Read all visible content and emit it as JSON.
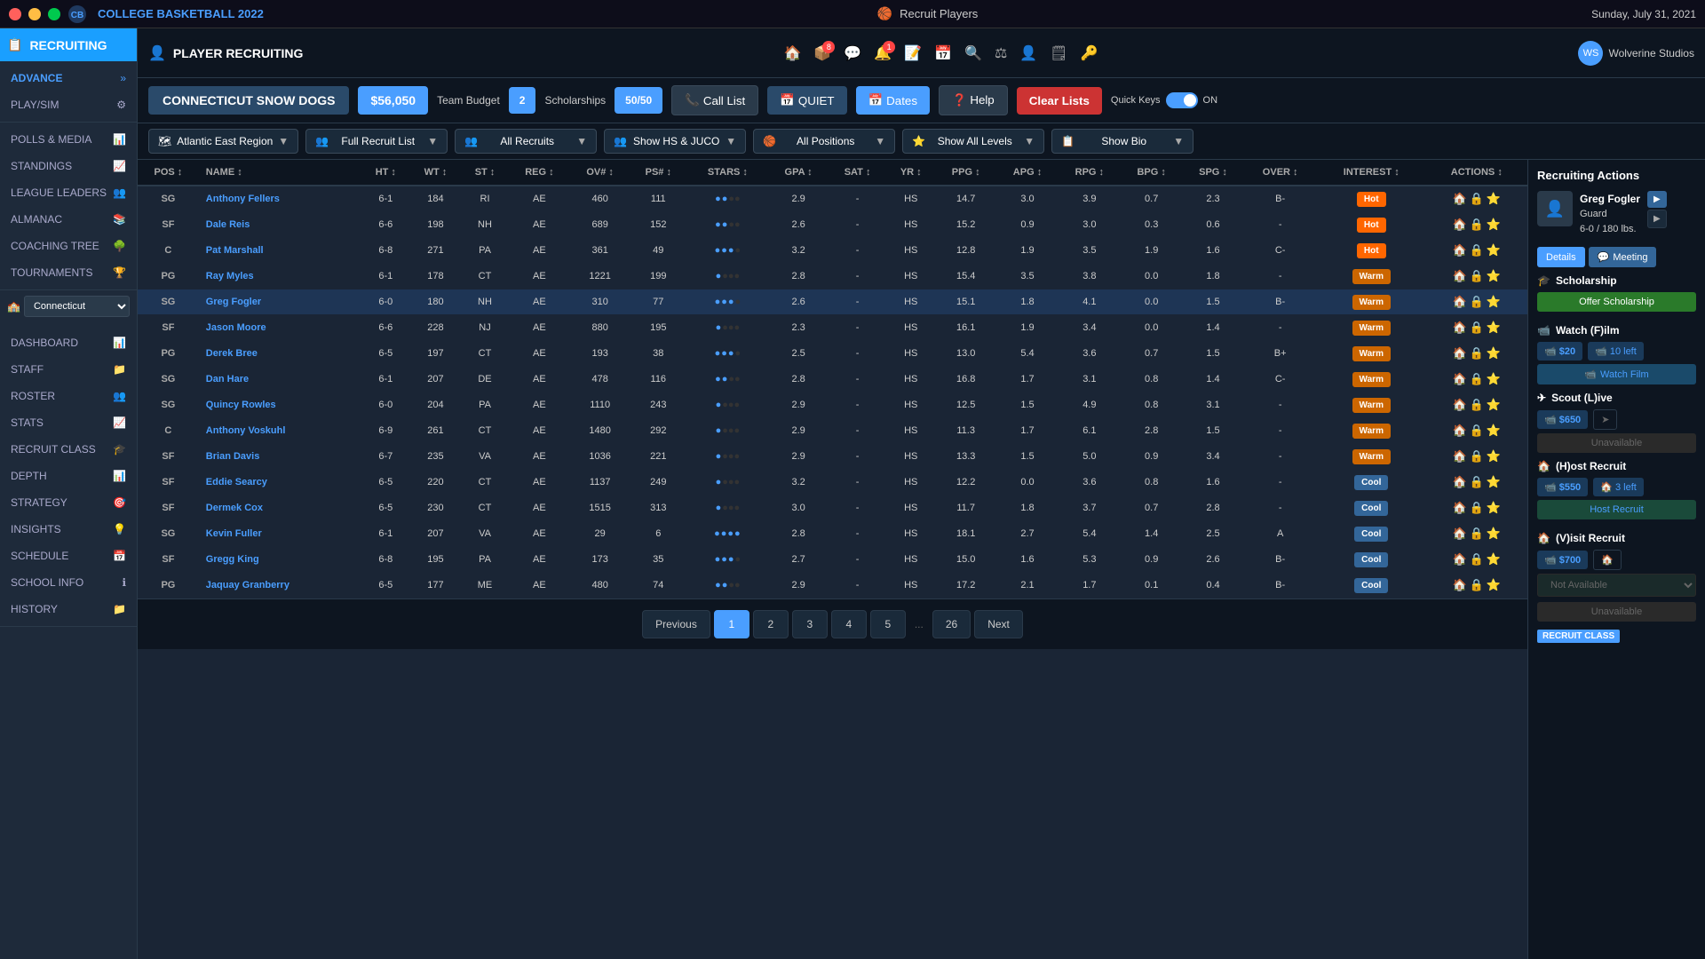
{
  "titleBar": {
    "title": "Recruit Players",
    "date": "Sunday, July 31, 2021",
    "gameName": "COLLEGE BASKETBALL 2022",
    "minLabel": "—",
    "maxLabel": "□",
    "closeLabel": "×"
  },
  "sidebar": {
    "activeSection": "RECRUITING",
    "sectionLabel": "RECRUITING",
    "items": [
      {
        "id": "advance",
        "label": "ADVANCE",
        "hasArrow": true
      },
      {
        "id": "play-sim",
        "label": "PLAY/SIM",
        "hasIcon": true
      },
      {
        "id": "polls-media",
        "label": "POLLS & MEDIA"
      },
      {
        "id": "standings",
        "label": "STANDINGS"
      },
      {
        "id": "league-leaders",
        "label": "LEAGUE LEADERS"
      },
      {
        "id": "almanac",
        "label": "ALMANAC"
      },
      {
        "id": "coaching-tree",
        "label": "COACHING TREE"
      },
      {
        "id": "tournaments",
        "label": "TOURNAMENTS"
      },
      {
        "id": "dashboard",
        "label": "DASHBOARD"
      },
      {
        "id": "staff",
        "label": "STAFF"
      },
      {
        "id": "roster",
        "label": "ROSTER"
      },
      {
        "id": "stats",
        "label": "STATS"
      },
      {
        "id": "recruit-class",
        "label": "RECRUIT CLASS"
      },
      {
        "id": "depth",
        "label": "DEPTH"
      },
      {
        "id": "strategy",
        "label": "STRATEGY"
      },
      {
        "id": "insights",
        "label": "INSIGHTS"
      },
      {
        "id": "schedule",
        "label": "SCHEDULE"
      },
      {
        "id": "school-info",
        "label": "SCHOOL INFO"
      },
      {
        "id": "history",
        "label": "HISTORY"
      }
    ],
    "teamLabel": "Connecticut"
  },
  "header": {
    "section": "PLAYER RECRUITING",
    "teamName": "CONNECTICUT SNOW DOGS",
    "budget": "$56,050",
    "budgetLabel": "Team Budget",
    "scholarships": "2",
    "scholarshipsLabel": "Scholarships",
    "slots": "50/50",
    "callListLabel": "Call List",
    "quietLabel": "QUIET",
    "datesLabel": "Dates",
    "helpLabel": "Help",
    "clearLabel": "Clear Lists",
    "quickKeysLabel": "Quick Keys",
    "toggleState": "ON"
  },
  "filters": {
    "region": "Atlantic East Region",
    "listType": "Full Recruit List",
    "recruits": "All Recruits",
    "school": "Show HS & JUCO",
    "positions": "All Positions",
    "levels": "Show All Levels",
    "bio": "Show Bio"
  },
  "table": {
    "columns": [
      "POS",
      "NAME",
      "HT",
      "WT",
      "ST",
      "REG",
      "OV#",
      "PS#",
      "STARS",
      "GPA",
      "SAT",
      "YR",
      "PPG",
      "APG",
      "RPG",
      "BPG",
      "SPG",
      "OVER",
      "INTEREST",
      "ACTIONS"
    ],
    "rows": [
      {
        "pos": "SG",
        "name": "Anthony Fellers",
        "ht": "6-1",
        "wt": "184",
        "st": "RI",
        "reg": "AE",
        "ov": "460",
        "ps": "111",
        "stars": 2,
        "gpa": "2.9",
        "sat": "-",
        "yr": "HS",
        "ppg": "14.7",
        "apg": "3.0",
        "rpg": "3.9",
        "bpg": "0.7",
        "spg": "2.3",
        "over": "B-",
        "interest": "Hot",
        "selected": false
      },
      {
        "pos": "SF",
        "name": "Dale Reis",
        "ht": "6-6",
        "wt": "198",
        "st": "NH",
        "reg": "AE",
        "ov": "689",
        "ps": "152",
        "stars": 2,
        "gpa": "2.6",
        "sat": "-",
        "yr": "HS",
        "ppg": "15.2",
        "apg": "0.9",
        "rpg": "3.0",
        "bpg": "0.3",
        "spg": "0.6",
        "over": "-",
        "interest": "Hot",
        "selected": false
      },
      {
        "pos": "C",
        "name": "Pat Marshall",
        "ht": "6-8",
        "wt": "271",
        "st": "PA",
        "reg": "AE",
        "ov": "361",
        "ps": "49",
        "stars": 3,
        "gpa": "3.2",
        "sat": "-",
        "yr": "HS",
        "ppg": "12.8",
        "apg": "1.9",
        "rpg": "3.5",
        "bpg": "1.9",
        "spg": "1.6",
        "over": "C-",
        "interest": "Hot",
        "selected": false
      },
      {
        "pos": "PG",
        "name": "Ray Myles",
        "ht": "6-1",
        "wt": "178",
        "st": "CT",
        "reg": "AE",
        "ov": "1221",
        "ps": "199",
        "stars": 1,
        "gpa": "2.8",
        "sat": "-",
        "yr": "HS",
        "ppg": "15.4",
        "apg": "3.5",
        "rpg": "3.8",
        "bpg": "0.0",
        "spg": "1.8",
        "over": "-",
        "interest": "Warm",
        "selected": false
      },
      {
        "pos": "SG",
        "name": "Greg Fogler",
        "ht": "6-0",
        "wt": "180",
        "st": "NH",
        "reg": "AE",
        "ov": "310",
        "ps": "77",
        "stars": 3,
        "gpa": "2.6",
        "sat": "-",
        "yr": "HS",
        "ppg": "15.1",
        "apg": "1.8",
        "rpg": "4.1",
        "bpg": "0.0",
        "spg": "1.5",
        "over": "B-",
        "interest": "Warm",
        "selected": true
      },
      {
        "pos": "SF",
        "name": "Jason Moore",
        "ht": "6-6",
        "wt": "228",
        "st": "NJ",
        "reg": "AE",
        "ov": "880",
        "ps": "195",
        "stars": 1,
        "gpa": "2.3",
        "sat": "-",
        "yr": "HS",
        "ppg": "16.1",
        "apg": "1.9",
        "rpg": "3.4",
        "bpg": "0.0",
        "spg": "1.4",
        "over": "-",
        "interest": "Warm",
        "selected": false
      },
      {
        "pos": "PG",
        "name": "Derek Bree",
        "ht": "6-5",
        "wt": "197",
        "st": "CT",
        "reg": "AE",
        "ov": "193",
        "ps": "38",
        "stars": 3,
        "gpa": "2.5",
        "sat": "-",
        "yr": "HS",
        "ppg": "13.0",
        "apg": "5.4",
        "rpg": "3.6",
        "bpg": "0.7",
        "spg": "1.5",
        "over": "B+",
        "interest": "Warm",
        "selected": false
      },
      {
        "pos": "SG",
        "name": "Dan Hare",
        "ht": "6-1",
        "wt": "207",
        "st": "DE",
        "reg": "AE",
        "ov": "478",
        "ps": "116",
        "stars": 2,
        "gpa": "2.8",
        "sat": "-",
        "yr": "HS",
        "ppg": "16.8",
        "apg": "1.7",
        "rpg": "3.1",
        "bpg": "0.8",
        "spg": "1.4",
        "over": "C-",
        "interest": "Warm",
        "selected": false
      },
      {
        "pos": "SG",
        "name": "Quincy Rowles",
        "ht": "6-0",
        "wt": "204",
        "st": "PA",
        "reg": "AE",
        "ov": "1110",
        "ps": "243",
        "stars": 1,
        "gpa": "2.9",
        "sat": "-",
        "yr": "HS",
        "ppg": "12.5",
        "apg": "1.5",
        "rpg": "4.9",
        "bpg": "0.8",
        "spg": "3.1",
        "over": "-",
        "interest": "Warm",
        "selected": false
      },
      {
        "pos": "C",
        "name": "Anthony Voskuhl",
        "ht": "6-9",
        "wt": "261",
        "st": "CT",
        "reg": "AE",
        "ov": "1480",
        "ps": "292",
        "stars": 1,
        "gpa": "2.9",
        "sat": "-",
        "yr": "HS",
        "ppg": "11.3",
        "apg": "1.7",
        "rpg": "6.1",
        "bpg": "2.8",
        "spg": "1.5",
        "over": "-",
        "interest": "Warm",
        "selected": false
      },
      {
        "pos": "SF",
        "name": "Brian Davis",
        "ht": "6-7",
        "wt": "235",
        "st": "VA",
        "reg": "AE",
        "ov": "1036",
        "ps": "221",
        "stars": 1,
        "gpa": "2.9",
        "sat": "-",
        "yr": "HS",
        "ppg": "13.3",
        "apg": "1.5",
        "rpg": "5.0",
        "bpg": "0.9",
        "spg": "3.4",
        "over": "-",
        "interest": "Warm",
        "selected": false
      },
      {
        "pos": "SF",
        "name": "Eddie Searcy",
        "ht": "6-5",
        "wt": "220",
        "st": "CT",
        "reg": "AE",
        "ov": "1137",
        "ps": "249",
        "stars": 1,
        "gpa": "3.2",
        "sat": "-",
        "yr": "HS",
        "ppg": "12.2",
        "apg": "0.0",
        "rpg": "3.6",
        "bpg": "0.8",
        "spg": "1.6",
        "over": "-",
        "interest": "Cool",
        "selected": false
      },
      {
        "pos": "SF",
        "name": "Dermek Cox",
        "ht": "6-5",
        "wt": "230",
        "st": "CT",
        "reg": "AE",
        "ov": "1515",
        "ps": "313",
        "stars": 1,
        "gpa": "3.0",
        "sat": "-",
        "yr": "HS",
        "ppg": "11.7",
        "apg": "1.8",
        "rpg": "3.7",
        "bpg": "0.7",
        "spg": "2.8",
        "over": "-",
        "interest": "Cool",
        "selected": false
      },
      {
        "pos": "SG",
        "name": "Kevin Fuller",
        "ht": "6-1",
        "wt": "207",
        "st": "VA",
        "reg": "AE",
        "ov": "29",
        "ps": "6",
        "stars": 4,
        "gpa": "2.8",
        "sat": "-",
        "yr": "HS",
        "ppg": "18.1",
        "apg": "2.7",
        "rpg": "5.4",
        "bpg": "1.4",
        "spg": "2.5",
        "over": "A",
        "interest": "Cool",
        "selected": false
      },
      {
        "pos": "SF",
        "name": "Gregg King",
        "ht": "6-8",
        "wt": "195",
        "st": "PA",
        "reg": "AE",
        "ov": "173",
        "ps": "35",
        "stars": 3,
        "gpa": "2.7",
        "sat": "-",
        "yr": "HS",
        "ppg": "15.0",
        "apg": "1.6",
        "rpg": "5.3",
        "bpg": "0.9",
        "spg": "2.6",
        "over": "B-",
        "interest": "Cool",
        "selected": false
      },
      {
        "pos": "PG",
        "name": "Jaquay Granberry",
        "ht": "6-5",
        "wt": "177",
        "st": "ME",
        "reg": "AE",
        "ov": "480",
        "ps": "74",
        "stars": 2,
        "gpa": "2.9",
        "sat": "-",
        "yr": "HS",
        "ppg": "17.2",
        "apg": "2.1",
        "rpg": "1.7",
        "bpg": "0.1",
        "spg": "0.4",
        "over": "B-",
        "interest": "Cool",
        "selected": false
      }
    ]
  },
  "pagination": {
    "previousLabel": "Previous",
    "nextLabel": "Next",
    "currentPage": 1,
    "pages": [
      "1",
      "2",
      "3",
      "4",
      "5",
      "...",
      "26"
    ]
  },
  "rightPanel": {
    "title": "Recruiting Actions",
    "recruitName": "Greg Fogler",
    "recruitPos": "Guard",
    "recruitStats": "6-0 / 180 lbs.",
    "detailsLabel": "Details",
    "meetingLabel": "Meeting",
    "scholarshipLabel": "Scholarship",
    "offerLabel": "Offer Scholarship",
    "watchFilmLabel": "Watch (F)ilm",
    "watchCost": "$20",
    "watchLeft": "10 left",
    "watchFilmBtnLabel": "Watch Film",
    "scoutLabel": "Scout (L)ive",
    "scoutCost": "$650",
    "scoutUnavailLabel": "Unavailable",
    "hostLabel": "(H)ost Recruit",
    "hostCost": "$550",
    "hostLeft": "3 left",
    "hostFilmBtnLabel": "Host Recruit",
    "visitLabel": "(V)isit Recruit",
    "visitCost": "$700",
    "visitNotAvailLabel": "Not Available",
    "visitUnavailLabel": "Unavailable",
    "recruitClassLabel": "RECRUIT CLASS"
  },
  "topBarIcons": {
    "icons": [
      "🏠",
      "📦",
      "💬",
      "🔔",
      "📝",
      "📅",
      "🔍",
      "⚖",
      "👤",
      "🗒",
      "🔑"
    ]
  },
  "user": {
    "name": "Wolverine Studios",
    "avatar": "WS"
  }
}
